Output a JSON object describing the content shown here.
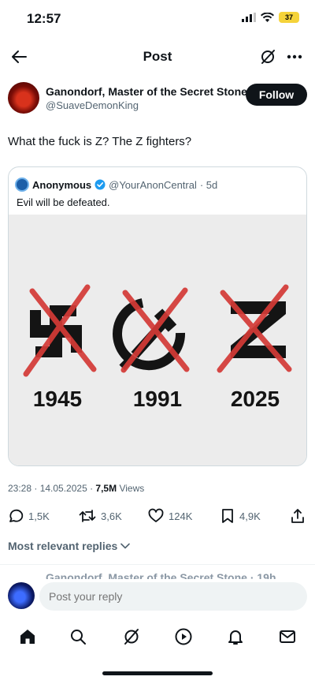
{
  "status_bar": {
    "time": "12:57",
    "battery": "37"
  },
  "nav": {
    "title": "Post"
  },
  "author": {
    "name": "Ganondorf, Master of the Secret Stone",
    "handle": "@SuaveDemonKing",
    "follow_label": "Follow"
  },
  "post": {
    "text": "What the fuck is Z? The Z fighters?",
    "timestamp": "23:28 · 14.05.2025 · ",
    "views_count": "7,5M",
    "views_label": " Views"
  },
  "quote": {
    "name": "Anonymous",
    "handle": "@YourAnonCentral",
    "age": "· 5d",
    "text": "Evil will be defeated.",
    "image_years": [
      "1945",
      "1991",
      "2025"
    ]
  },
  "actions": {
    "replies": "1,5K",
    "reposts": "3,6K",
    "likes": "124K",
    "bookmarks": "4,9K"
  },
  "replies_section": {
    "label": "Most relevant replies",
    "peek": "Ganondorf, Master of the Secret Stone · 19h"
  },
  "reply_bar": {
    "placeholder": "Post your reply"
  },
  "colors": {
    "accent": "#1d9bf0",
    "cross_red": "#d43a36",
    "text": "#0f1419",
    "muted": "#536471"
  }
}
